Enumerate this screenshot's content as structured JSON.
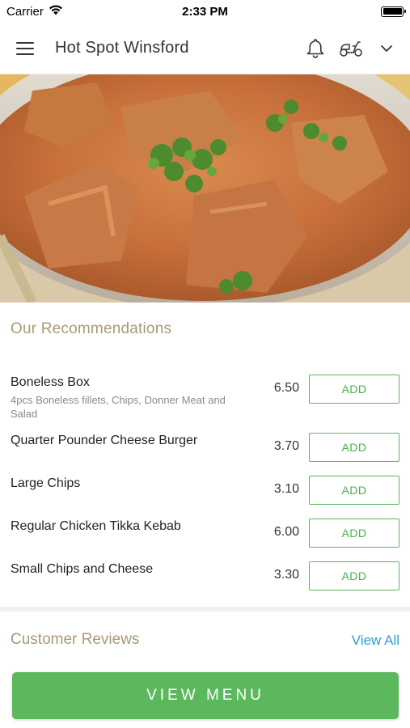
{
  "status_bar": {
    "carrier": "Carrier",
    "time": "2:33 PM"
  },
  "header": {
    "title": "Hot Spot Winsford",
    "icons": [
      "menu-icon",
      "bell-icon",
      "scooter-icon",
      "chevron-down-icon"
    ]
  },
  "recommendations": {
    "title": "Our Recommendations",
    "items": [
      {
        "name": "Boneless Box",
        "description": "4pcs Boneless fillets, Chips, Donner Meat and Salad",
        "price": "6.50",
        "button": "ADD"
      },
      {
        "name": "Quarter Pounder Cheese Burger",
        "description": "",
        "price": "3.70",
        "button": "ADD"
      },
      {
        "name": "Large Chips",
        "description": "",
        "price": "3.10",
        "button": "ADD"
      },
      {
        "name": "Regular Chicken Tikka Kebab",
        "description": "",
        "price": "6.00",
        "button": "ADD"
      },
      {
        "name": "Small Chips and Cheese",
        "description": "",
        "price": "3.30",
        "button": "ADD"
      }
    ]
  },
  "reviews": {
    "title": "Customer Reviews",
    "view_all": "View All"
  },
  "cta": {
    "label": "VIEW MENU"
  },
  "colors": {
    "accent_green": "#5cb85c",
    "section_title": "#a99a76",
    "link_blue": "#2a9fd6"
  }
}
